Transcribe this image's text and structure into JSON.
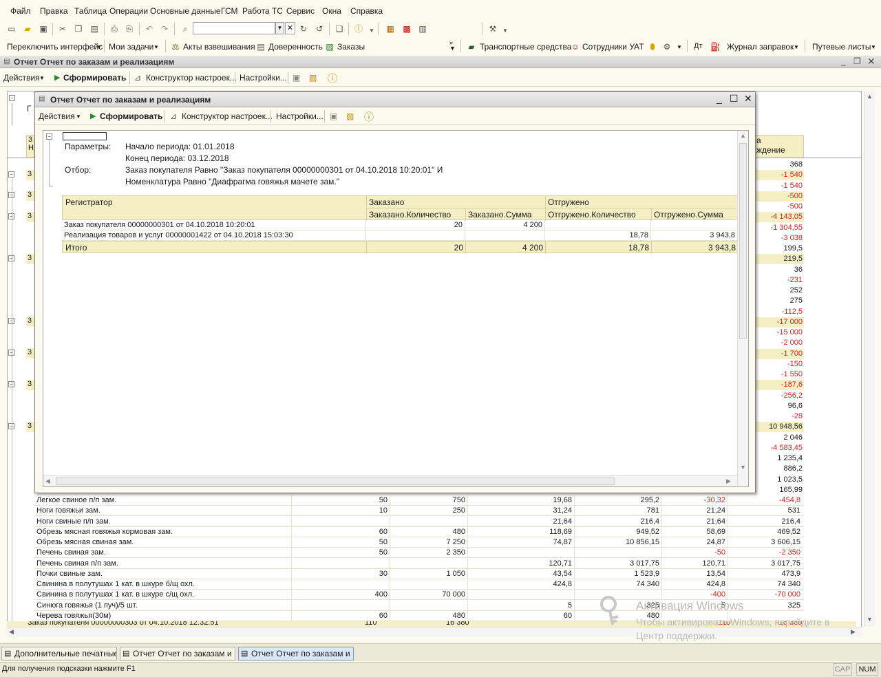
{
  "menu": [
    "Файл",
    "Правка",
    "Таблица",
    "Операции",
    "Основные данные",
    "ГСМ",
    "Работа ТС",
    "Сервис",
    "Окна",
    "Справка"
  ],
  "toolbar2": {
    "switch_interface": "Переключить интерфейс",
    "my_tasks": "Мои задачи",
    "acts": "Акты взвешивания",
    "proxy": "Доверенность",
    "orders": "Заказы",
    "transport": "Транспортные средства",
    "staff": "Сотрудники УАТ",
    "dt": "Дт",
    "fuel_log": "Журнал заправок",
    "waybills": "Путевые листы",
    "m": "М",
    "mplus": "М+",
    "mminus": "М-"
  },
  "main_window": {
    "title": "Отчет  Отчет по заказам и реализациям",
    "actions": "Действия",
    "generate": "Сформировать",
    "constructor": "Конструктор настроек...",
    "settings": "Настройки..."
  },
  "background": {
    "header_fragment": "Г",
    "col_header_partial": [
      "а",
      "ждение"
    ],
    "left_codes": [
      "3",
      "Н"
    ],
    "right_values": [
      {
        "v": "368",
        "neg": false
      },
      {
        "v": "-1 540",
        "neg": true
      },
      {
        "v": "-1 540",
        "neg": true
      },
      {
        "v": "-500",
        "neg": true
      },
      {
        "v": "-500",
        "neg": true
      },
      {
        "v": "-4 143,05",
        "neg": true
      },
      {
        "v": "-1 304,55",
        "neg": true
      },
      {
        "v": "-3 038",
        "neg": true
      },
      {
        "v": "199,5",
        "neg": false
      },
      {
        "v": "219,5",
        "neg": false
      },
      {
        "v": "36",
        "neg": false
      },
      {
        "v": "-231",
        "neg": true
      },
      {
        "v": "252",
        "neg": false
      },
      {
        "v": "275",
        "neg": false
      },
      {
        "v": "-112,5",
        "neg": true
      },
      {
        "v": "-17 000",
        "neg": true
      },
      {
        "v": "-15 000",
        "neg": true
      },
      {
        "v": "-2 000",
        "neg": true
      },
      {
        "v": "-1 700",
        "neg": true
      },
      {
        "v": "-150",
        "neg": true
      },
      {
        "v": "-1 550",
        "neg": true
      },
      {
        "v": "-187,6",
        "neg": true
      },
      {
        "v": "-256,2",
        "neg": true
      },
      {
        "v": "96,6",
        "neg": false
      },
      {
        "v": "-28",
        "neg": true
      },
      {
        "v": "10 948,56",
        "neg": false
      },
      {
        "v": "2 046",
        "neg": false
      },
      {
        "v": "-4 583,45",
        "neg": true
      },
      {
        "v": "1 235,4",
        "neg": false
      },
      {
        "v": "886,2",
        "neg": false
      },
      {
        "v": "1 023,5",
        "neg": false
      },
      {
        "v": "165,99",
        "neg": false
      }
    ],
    "rows": [
      {
        "name": "Легкое свиное п/п зам.",
        "q": "50",
        "s": "750",
        "sq": "19,68",
        "ss": "295,2",
        "dq": "-30,32",
        "ds": "-454,8",
        "dqn": true,
        "dsn": true
      },
      {
        "name": "Ноги говяжьи зам.",
        "q": "10",
        "s": "250",
        "sq": "31,24",
        "ss": "781",
        "dq": "21,24",
        "ds": "531",
        "dqn": false,
        "dsn": false
      },
      {
        "name": "Ноги свиные п/п зам.",
        "q": "",
        "s": "",
        "sq": "21,64",
        "ss": "216,4",
        "dq": "21,64",
        "ds": "216,4",
        "dqn": false,
        "dsn": false
      },
      {
        "name": "Обрезь мясная говяжья кормовая зам.",
        "q": "60",
        "s": "480",
        "sq": "118,69",
        "ss": "949,52",
        "dq": "58,69",
        "ds": "469,52",
        "dqn": false,
        "dsn": false
      },
      {
        "name": "Обрезь мясная свиная зам.",
        "q": "50",
        "s": "7 250",
        "sq": "74,87",
        "ss": "10 856,15",
        "dq": "24,87",
        "ds": "3 606,15",
        "dqn": false,
        "dsn": false
      },
      {
        "name": "Печень свиная зам.",
        "q": "50",
        "s": "2 350",
        "sq": "",
        "ss": "",
        "dq": "-50",
        "ds": "-2 350",
        "dqn": true,
        "dsn": true
      },
      {
        "name": "Печень свиная п/п зам.",
        "q": "",
        "s": "",
        "sq": "120,71",
        "ss": "3 017,75",
        "dq": "120,71",
        "ds": "3 017,75",
        "dqn": false,
        "dsn": false
      },
      {
        "name": "Почки свиные  зам.",
        "q": "30",
        "s": "1 050",
        "sq": "43,54",
        "ss": "1 523,9",
        "dq": "13,54",
        "ds": "473,9",
        "dqn": false,
        "dsn": false
      },
      {
        "name": "Свинина в полутушах 1 кат. в шкуре б/щ охл.",
        "q": "",
        "s": "",
        "sq": "424,8",
        "ss": "74 340",
        "dq": "424,8",
        "ds": "74 340",
        "dqn": false,
        "dsn": false
      },
      {
        "name": "Свинина в полутушах 1 кат. в шкуре с/щ охл.",
        "q": "400",
        "s": "70 000",
        "sq": "",
        "ss": "",
        "dq": "-400",
        "ds": "-70 000",
        "dqn": true,
        "dsn": true
      },
      {
        "name": "Синюга говяжья (1 пуч)/5 шт.",
        "q": "",
        "s": "",
        "sq": "5",
        "ss": "325",
        "dq": "5",
        "ds": "325",
        "dqn": false,
        "dsn": false
      },
      {
        "name": "Черева говяжья(30м)",
        "q": "60",
        "s": "480",
        "sq": "60",
        "ss": "480",
        "dq": "",
        "ds": "",
        "dqn": false,
        "dsn": false
      }
    ],
    "partial_row": {
      "name": "Заказ покупателя 00000000303 от 04.10.2018 12:32:51",
      "q": "110",
      "s": "16 380",
      "dq": "-110",
      "ds": "-16 380"
    }
  },
  "modal": {
    "title": "Отчет  Отчет по заказам и реализациям",
    "actions": "Действия",
    "generate": "Сформировать",
    "constructor": "Конструктор настроек...",
    "settings": "Настройки...",
    "params_label": "Параметры:",
    "period_start": "Начало периода: 01.01.2018",
    "period_end": "Конец периода: 03.12.2018",
    "filter_label": "Отбор:",
    "filter_line1": "Заказ покупателя Равно \"Заказ покупателя 00000000301 от 04.10.2018 10:20:01\" И",
    "filter_line2": "Номенклатура Равно \"Диафрагма говяжья мачете зам.\"",
    "table": {
      "col_registrar": "Регистратор",
      "grp_ordered": "Заказано",
      "grp_shipped": "Отгружено",
      "cols": [
        "Заказано.Количество",
        "Заказано.Сумма",
        "Отгружено.Количество",
        "Отгружено.Сумма"
      ],
      "rows": [
        {
          "name": "Заказ покупателя 00000000301 от 04.10.2018 10:20:01",
          "q": "20",
          "s": "4 200",
          "sq": "",
          "ss": ""
        },
        {
          "name": "Реализация товаров и услуг 00000001422 от 04.10.2018 15:03:30",
          "q": "",
          "s": "",
          "sq": "18,78",
          "ss": "3 943,8"
        }
      ],
      "total": {
        "label": "Итого",
        "q": "20",
        "s": "4 200",
        "sq": "18,78",
        "ss": "3 943,8"
      }
    }
  },
  "taskbar": [
    "Дополнительные печатные...",
    "Отчет  Отчет по заказам и ...",
    "Отчет  Отчет по заказам и ..."
  ],
  "status": {
    "hint": "Для получения подсказки нажмите F1",
    "cap": "CAP",
    "num": "NUM"
  },
  "watermark": {
    "line1": "Активация Windows",
    "line2": "Чтобы активировать Windows, перейдите в",
    "line3": "Центр поддержки."
  },
  "colors": {
    "accent_header": "#f5efc6",
    "negative": "#d81e1e",
    "background": "#fbfaef"
  }
}
